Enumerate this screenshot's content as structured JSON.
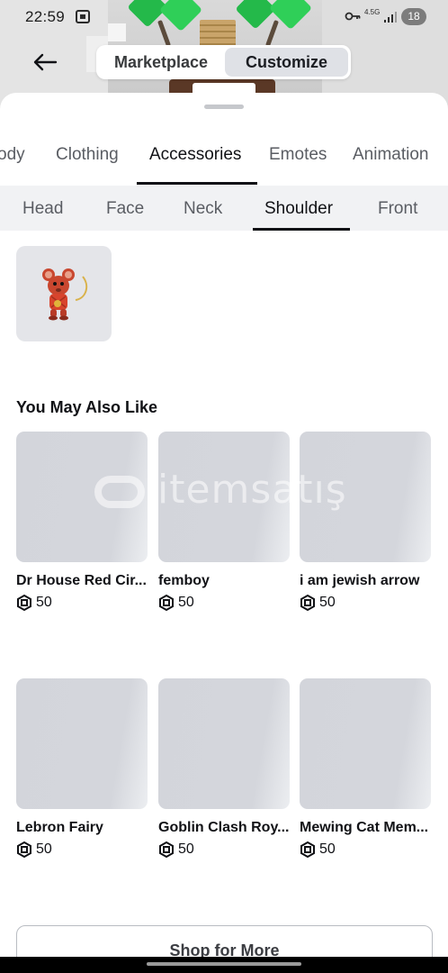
{
  "status_bar": {
    "time": "22:59",
    "network_label": "4.5G",
    "battery": "18"
  },
  "header": {
    "segments": [
      "Marketplace",
      "Customize"
    ],
    "active_segment": "Customize"
  },
  "category_tabs": {
    "items": [
      "Body",
      "Clothing",
      "Accessories",
      "Emotes",
      "Animation"
    ],
    "visible_text": [
      "ody",
      "Clothing",
      "Accessories",
      "Emotes",
      "Animation"
    ],
    "active": "Accessories"
  },
  "subcategory_tabs": {
    "items": [
      "Head",
      "Face",
      "Neck",
      "Shoulder",
      "Front"
    ],
    "active": "Shoulder"
  },
  "equipped": {
    "items": [
      {
        "icon": "red-mouse-accessory"
      }
    ]
  },
  "recommendations": {
    "title": "You May Also Like",
    "items": [
      {
        "name": "Dr House Red Cir...",
        "price": "50"
      },
      {
        "name": "femboy",
        "price": "50"
      },
      {
        "name": "i am jewish arrow",
        "price": "50"
      },
      {
        "name": "Lebron Fairy",
        "price": "50"
      },
      {
        "name": "Goblin Clash Roy...",
        "price": "50"
      },
      {
        "name": "Mewing Cat Mem...",
        "price": "50"
      }
    ]
  },
  "watermark": {
    "text": "itemsatış"
  },
  "shop_button": {
    "label": "Shop for More"
  },
  "colors": {
    "accent_text": "#111216",
    "thumb_placeholder": "#d3d5db",
    "tab_bar_bg": "#f1f2f4"
  }
}
